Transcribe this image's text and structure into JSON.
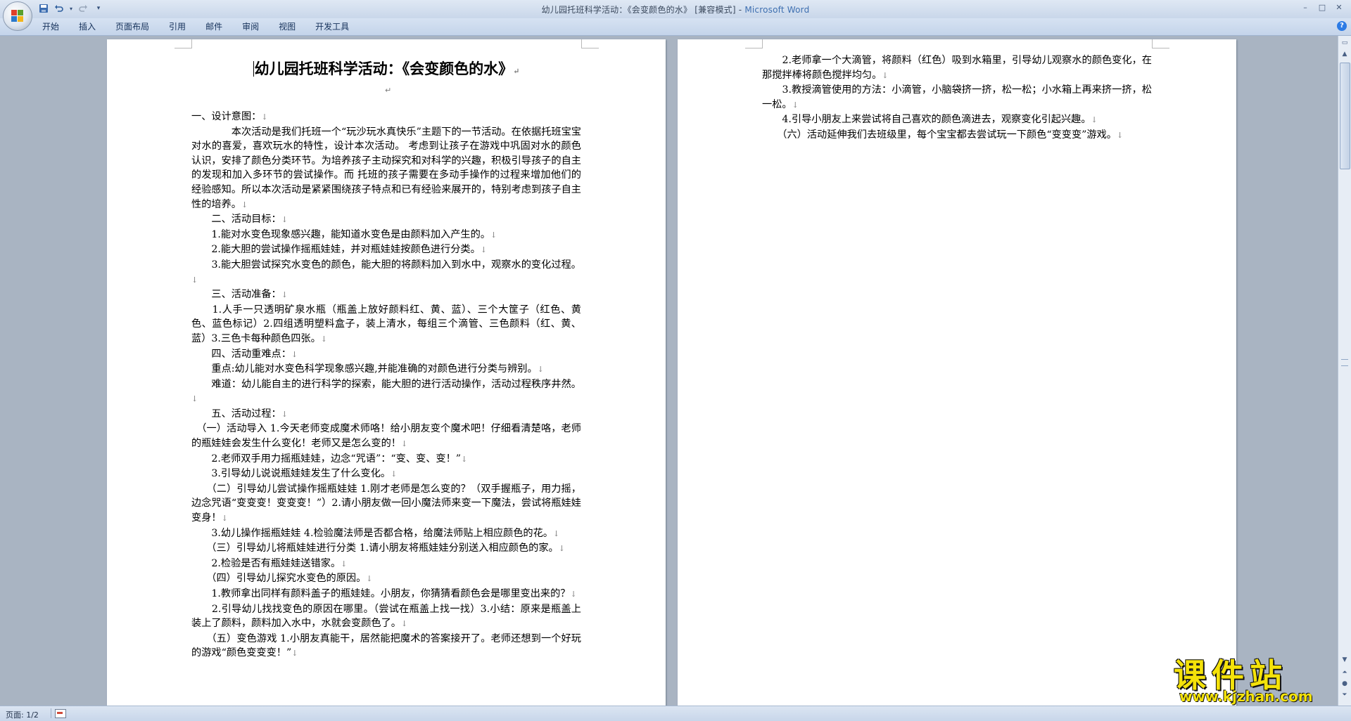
{
  "window": {
    "title_doc": "幼儿园托班科学活动：《会变颜色的水》 [兼容模式] - ",
    "title_app": "Microsoft Word",
    "controls": [
      "–",
      "□",
      "✕"
    ]
  },
  "quick_access": {
    "save_icon": "save-icon",
    "undo_icon": "undo-icon",
    "redo_icon": "redo-icon",
    "customize_icon": "customize-qat-icon"
  },
  "ribbon": {
    "tabs": [
      "开始",
      "插入",
      "页面布局",
      "引用",
      "邮件",
      "审阅",
      "视图",
      "开发工具"
    ],
    "help": "?"
  },
  "document": {
    "title": "幼儿园托班科学活动：《会变颜色的水》",
    "page1": [
      "一、设计意图：",
      "　　　　本次活动是我们托班一个“玩沙玩水真快乐”主题下的一节活动。在依据托班宝宝对水的喜爱，喜欢玩水的特性，设计本次活动。 考虑到让孩子在游戏中巩固对水的颜色认识，安排了颜色分类环节。为培养孩子主动探究和对科学的兴趣，积极引导孩子的自主的发现和加入多环节的尝试操作。而 托班的孩子需要在多动手操作的过程来增加他们的经验感知。所以本次活动是紧紧围绕孩子特点和已有经验来展开的，特别考虑到孩子自主性的培养。",
      "　　二、活动目标：",
      "　　1.能对水变色现象感兴趣，能知道水变色是由颜料加入产生的。",
      "　　2.能大胆的尝试操作摇瓶娃娃，并对瓶娃娃按颜色进行分类。",
      "　　3.能大胆尝试探究水变色的颜色，能大胆的将颜料加入到水中，观察水的变化过程。",
      "　　三、活动准备：",
      "　　1.人手一只透明矿泉水瓶（瓶盖上放好颜料红、黄、蓝）、三个大筐子（红色、黄色、蓝色标记）2.四组透明塑料盒子，装上清水，每组三个滴管、三色颜料（红、黄、蓝）3.三色卡每种颜色四张。",
      "　　四、活动重难点：",
      "　　重点:幼儿能对水变色科学现象感兴趣,并能准确的对颜色进行分类与辨别。",
      "　　难道：幼儿能自主的进行科学的探索，能大胆的进行活动操作，活动过程秩序井然。",
      "　　五、活动过程：",
      "　（一）活动导入 1.今天老师变成魔术师咯！给小朋友变个魔术吧！仔细看清楚咯，老师的瓶娃娃会发生什么变化！老师又是怎么变的！",
      "　　2.老师双手用力摇瓶娃娃，边念“咒语”：“变、变、变！”",
      "　　3.引导幼儿说说瓶娃娃发生了什么变化。",
      "　　（二）引导幼儿尝试操作摇瓶娃娃 1.刚才老师是怎么变的？（双手握瓶子，用力摇，边念咒语“变变变！变变变！”）2.请小朋友做一回小魔法师来变一下魔法，尝试将瓶娃娃变身！",
      "　　3.幼儿操作摇瓶娃娃 4.检验魔法师是否都合格，给魔法师贴上相应颜色的花。",
      "　　（三）引导幼儿将瓶娃娃进行分类 1.请小朋友将瓶娃娃分别送入相应颜色的家。",
      "　　2.检验是否有瓶娃娃送错家。",
      "　　（四）引导幼儿探究水变色的原因。",
      "　　1.教师拿出同样有颜料盖子的瓶娃娃。小朋友，你猜猜看颜色会是哪里变出来的？",
      "　　2.引导幼儿找找变色的原因在哪里。（尝试在瓶盖上找一找）3.小结：原来是瓶盖上装上了颜料，颜料加入水中，水就会变颜色了。",
      "　　（五）变色游戏 1.小朋友真能干，居然能把魔术的答案接开了。老师还想到一个好玩的游戏“颜色变变变！”"
    ],
    "page2": [
      "　　2.老师拿一个大滴管，将颜料（红色）吸到水箱里，引导幼儿观察水的颜色变化，在那搅拌棒将颜色搅拌均匀。",
      "　　3.教授滴管使用的方法：小滴管，小脑袋挤一挤，松一松；小水箱上再来挤一挤，松一松。",
      "　　4.引导小朋友上来尝试将自己喜欢的颜色滴进去，观察变化引起兴趣。",
      "　　（六）活动延伸我们去班级里，每个宝宝都去尝试玩一下颜色“变变变”游戏。"
    ]
  },
  "statusbar": {
    "page_info": "页面: 1/2"
  },
  "watermark": {
    "main": "课件站",
    "sub": "www.kjzhan.com"
  },
  "colors": {
    "brand": "#3e6fb0",
    "watermark": "#f4e20a"
  }
}
